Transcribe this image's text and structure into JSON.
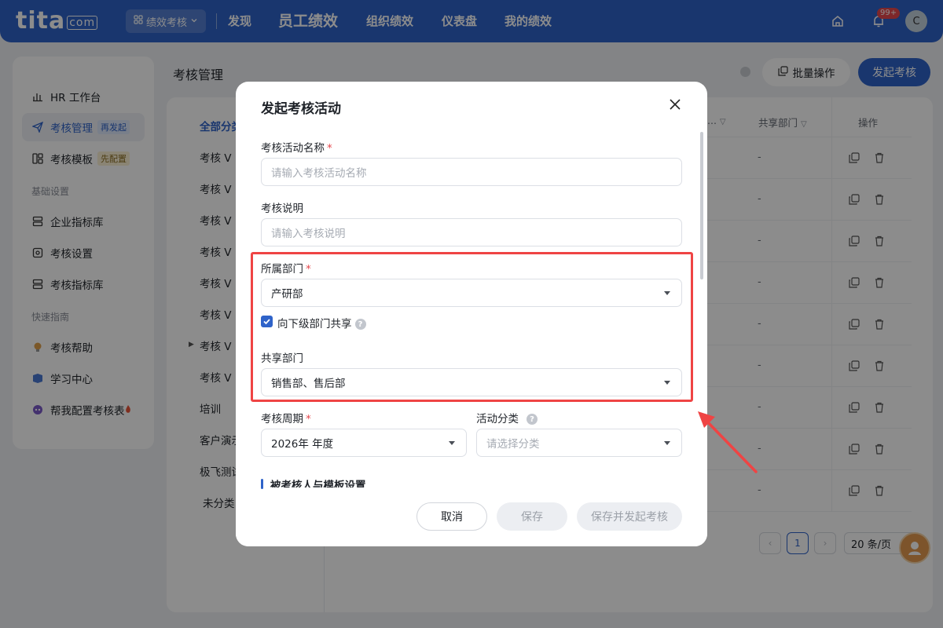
{
  "topbar": {
    "logo": "tita",
    "logo_suffix": "com",
    "app_switch": "绩效考核",
    "nav": [
      "发现",
      "员工绩效",
      "组织绩效",
      "仪表盘",
      "我的绩效"
    ],
    "notification_count": "99+",
    "avatar_initial": "C"
  },
  "sidebar": {
    "items": [
      {
        "label": "HR 工作台",
        "icon": "bar-chart-icon"
      },
      {
        "label": "考核管理",
        "tag": "再发起",
        "icon": "send-icon"
      },
      {
        "label": "考核模板",
        "tag": "先配置",
        "icon": "template-icon"
      }
    ],
    "section_basic": "基础设置",
    "basic_items": [
      {
        "label": "企业指标库",
        "icon": "database-icon"
      },
      {
        "label": "考核设置",
        "icon": "settings-icon"
      },
      {
        "label": "考核指标库",
        "icon": "database-icon"
      }
    ],
    "section_guide": "快速指南",
    "guide_items": [
      {
        "label": "考核帮助",
        "icon": "bulb-icon"
      },
      {
        "label": "学习中心",
        "icon": "book-icon"
      },
      {
        "label": "帮我配置考核表",
        "icon": "robot-icon"
      }
    ]
  },
  "page": {
    "title": "考核管理",
    "batch_label": "批量操作",
    "start_label": "发起考核"
  },
  "categories": [
    "全部分类",
    "考核 V",
    "考核 V",
    "考核 V",
    "考核 V",
    "考核 V",
    "考核 V",
    "考核 V",
    "考核 V",
    "培训",
    "客户演示",
    "极飞测试",
    "未分类"
  ],
  "table": {
    "header_trunc": "...",
    "header_shared": "共享部门",
    "header_op": "操作",
    "dash": "-"
  },
  "pagination": {
    "current": "1",
    "page_size": "20 条/页"
  },
  "modal": {
    "title": "发起考核活动",
    "name_label": "考核活动名称",
    "name_placeholder": "请输入考核活动名称",
    "desc_label": "考核说明",
    "desc_placeholder": "请输入考核说明",
    "dept_label": "所属部门",
    "dept_value": "产研部",
    "share_checkbox": "向下级部门共享",
    "share_checked": true,
    "shared_label": "共享部门",
    "shared_value": "销售部、售后部",
    "cycle_label": "考核周期",
    "cycle_value": "2026年 年度",
    "category_label": "活动分类",
    "category_placeholder": "请选择分类",
    "section_title": "被考核人与模板设置",
    "cancel": "取消",
    "save": "保存",
    "save_start": "保存并发起考核"
  },
  "colors": {
    "primary": "#2f63c9",
    "required": "#e5484d",
    "highlight": "#ef4444"
  }
}
